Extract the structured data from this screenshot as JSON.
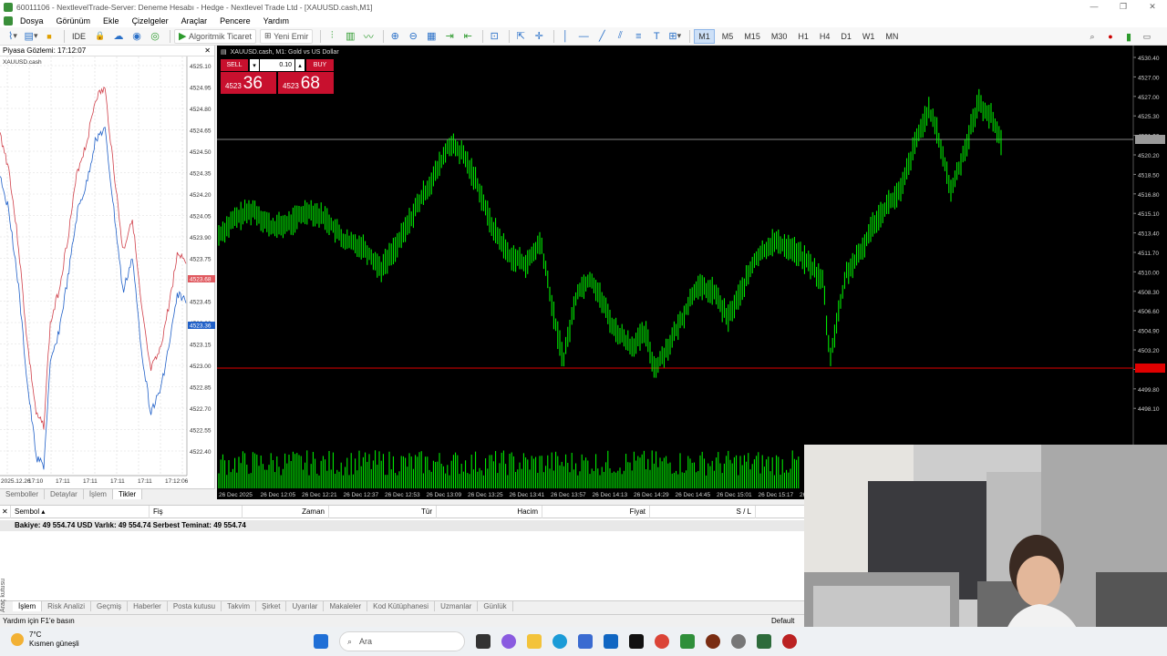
{
  "window": {
    "title": "60011106 - NextlevelTrade-Server: Deneme Hesabı - Hedge - Nextlevel Trade Ltd - [XAUUSD.cash,M1]",
    "controls": [
      "—",
      "❐",
      "✕"
    ]
  },
  "menu": [
    "Dosya",
    "Görünüm",
    "Ekle",
    "Çizelgeler",
    "Araçlar",
    "Pencere",
    "Yardım"
  ],
  "toolbar": {
    "ide_label": "IDE",
    "algo_label": "Algoritmik Ticaret",
    "new_order_label": "Yeni Emir",
    "timeframes": [
      "M1",
      "M5",
      "M15",
      "M30",
      "H1",
      "H4",
      "D1",
      "W1",
      "MN"
    ],
    "active_timeframe": "M1"
  },
  "market_watch": {
    "title": "Piyasa Gözlemi: 17:12:07",
    "symbol": "XAUUSD.cash",
    "price_labels": [
      "4525.10",
      "4524.95",
      "4524.80",
      "4524.65",
      "4524.50",
      "4524.35",
      "4524.20",
      "4524.05",
      "4523.90",
      "4523.75",
      "4523.60",
      "4523.45",
      "4523.30",
      "4523.15",
      "4523.00",
      "4522.85",
      "4522.70",
      "4522.55",
      "4522.40"
    ],
    "ask_tag": "4523.68",
    "bid_tag": "4523.36",
    "time_labels": [
      "2025.12.26",
      "17:10",
      "17:11",
      "17:11",
      "17:11",
      "17:11",
      "17:12:06"
    ],
    "tabs": [
      "Semboller",
      "Detaylar",
      "İşlem",
      "Tikler"
    ],
    "active_tab": "Tikler"
  },
  "chart": {
    "title": "XAUUSD.cash, M1:  Gold vs US Dollar",
    "sell_label": "SELL",
    "buy_label": "BUY",
    "lot": "0.10",
    "sell_price_small": "4523",
    "sell_price_big": "36",
    "buy_price_small": "4523",
    "buy_price_big": "68",
    "price_axis": [
      "4530.40",
      "4527.00",
      "4527.00",
      "4525.30",
      "4521.90",
      "4520.20",
      "4518.50",
      "4516.80",
      "4515.10",
      "4513.40",
      "4511.70",
      "4510.00",
      "4508.30",
      "4506.60",
      "4504.90",
      "4503.20",
      "4501.50",
      "4499.80",
      "4498.10"
    ],
    "time_axis": [
      "26 Dec 2025",
      "26 Dec 12:05",
      "26 Dec 12:21",
      "26 Dec 12:37",
      "26 Dec 12:53",
      "26 Dec 13:09",
      "26 Dec 13:25",
      "26 Dec 13:41",
      "26 Dec 13:57",
      "26 Dec 14:13",
      "26 Dec 14:29",
      "26 Dec 14:45",
      "26 Dec 15:01",
      "26 Dec 15:17",
      "26 Dec 15:33"
    ],
    "colors": {
      "background": "#000000",
      "candle": "#00ff00",
      "bid_line": "#b0b0b0",
      "ask_line": "#e00000"
    }
  },
  "toolbox": {
    "columns": [
      "Sembol",
      "Fiş",
      "Zaman",
      "Tür",
      "Hacim",
      "Fiyat",
      "S / L"
    ],
    "balance": "Bakiye: 49 554.74 USD  Varlık: 49 554.74  Serbest Teminat: 49 554.74",
    "tabs": [
      "İşlem",
      "Risk Analizi",
      "Geçmiş",
      "Haberler",
      "Posta kutusu",
      "Takvim",
      "Şirket",
      "Uyarılar",
      "Makaleler",
      "Kod Kütüphanesi",
      "Uzmanlar",
      "Günlük"
    ],
    "active_tab": "İşlem",
    "side_label": "Araç kutusu"
  },
  "status": {
    "help": "Yardım için F1'e basın",
    "profile": "Default"
  },
  "taskbar": {
    "temp": "7°C",
    "weather": "Kısmen güneşli",
    "search_placeholder": "Ara"
  }
}
